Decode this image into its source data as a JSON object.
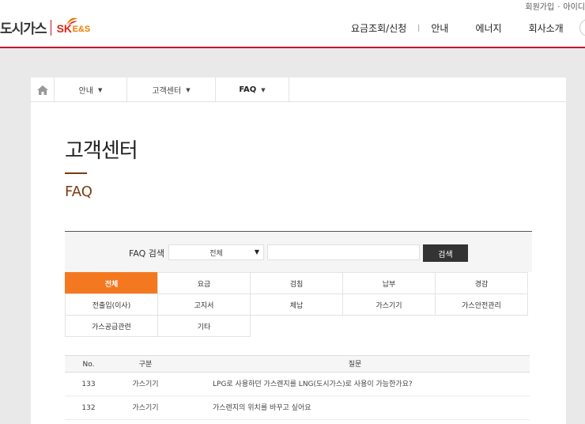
{
  "header": {
    "top_links": [
      "회원가입",
      "·",
      "아이디"
    ],
    "logo_text": "도시가스",
    "brand_sk": "SK",
    "brand_es": "E&S",
    "nav": [
      "요금조회/신청",
      "안내",
      "에너지",
      "회사소개"
    ]
  },
  "breadcrumb": {
    "items": [
      "안내",
      "고객센터",
      "FAQ"
    ]
  },
  "page": {
    "title": "고객센터",
    "subtitle": "FAQ"
  },
  "search": {
    "label": "FAQ 검색",
    "select_value": "전체",
    "input_value": "",
    "button_label": "검색"
  },
  "categories": [
    "전체",
    "요금",
    "검침",
    "납부",
    "경감",
    "전출입(이사)",
    "고지서",
    "체납",
    "가스기기",
    "가스안전관리",
    "가스공급관련",
    "기타"
  ],
  "active_category": "전체",
  "table": {
    "headers": [
      "No.",
      "구분",
      "질문"
    ],
    "rows": [
      {
        "no": "133",
        "category": "가스기기",
        "question": "LPG로 사용하던 가스렌지를 LNG(도시가스)로 사용이 가능한가요?"
      },
      {
        "no": "132",
        "category": "가스기기",
        "question": "가스렌지의 위치를 바꾸고 싶어요"
      }
    ]
  },
  "colors": {
    "accent_orange": "#f47820",
    "brand_red": "#c8102e",
    "title_brown": "#7a3b10"
  }
}
